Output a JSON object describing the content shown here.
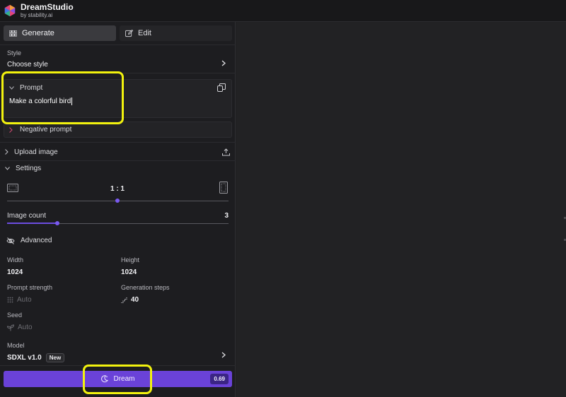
{
  "app": {
    "name": "DreamStudio",
    "byline": "by stability.ai"
  },
  "tabs": [
    {
      "label": "Generate",
      "icon": "grid-icon",
      "active": true
    },
    {
      "label": "Edit",
      "icon": "edit-icon",
      "active": false
    }
  ],
  "style": {
    "label": "Style",
    "value": "Choose style"
  },
  "prompt": {
    "label": "Prompt",
    "value": "Make a colorful bird"
  },
  "negative_prompt": {
    "label": "Negative prompt"
  },
  "upload": {
    "label": "Upload image"
  },
  "settings": {
    "label": "Settings",
    "aspect_ratio": "1 : 1",
    "image_count_label": "Image count",
    "image_count": "3",
    "advanced_label": "Advanced",
    "width_label": "Width",
    "width": "1024",
    "height_label": "Height",
    "height": "1024",
    "prompt_strength_label": "Prompt strength",
    "prompt_strength": "Auto",
    "generation_steps_label": "Generation steps",
    "generation_steps": "40",
    "seed_label": "Seed",
    "seed": "Auto"
  },
  "model": {
    "label": "Model",
    "value": "SDXL v1.0",
    "badge": "New"
  },
  "dream": {
    "label": "Dream",
    "credits": "0.69"
  },
  "colors": {
    "accent": "#6a42d8",
    "highlight": "#f2f20e",
    "background": "#1d1d20"
  }
}
